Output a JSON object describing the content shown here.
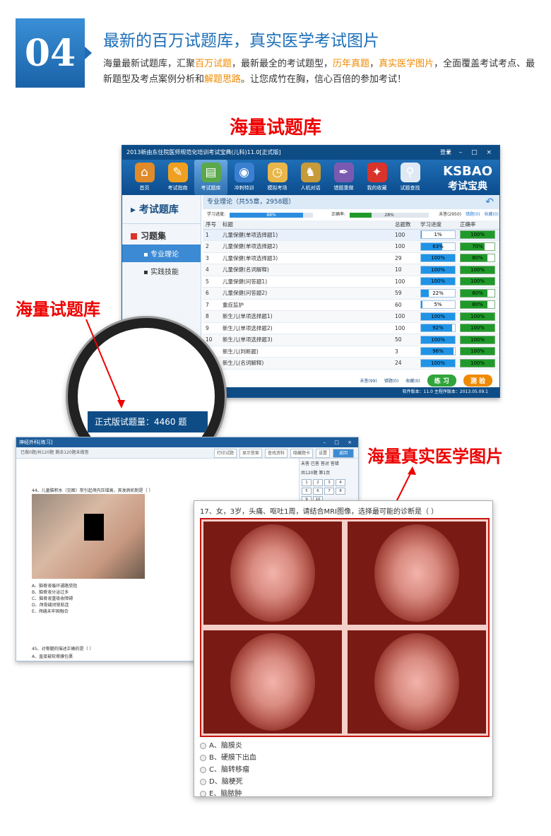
{
  "header": {
    "number": "04",
    "title": "最新的百万试题库，真实医学考试图片",
    "desc_parts": [
      "海量最新试题库，汇聚",
      "百万试题",
      "，最新最全的考试题型，",
      "历年真题",
      "，",
      "真实医学图片",
      "，全面覆盖考试考点、最新题型及考点案例分析和",
      "解题思路",
      "。让您成竹在胸，信心百倍的参加考试！"
    ]
  },
  "section1_title": "海量试题库",
  "app": {
    "window_title": "2013新由东住院医师规范化培训考试宝典(儿科)11.0[正式版]",
    "login": "登录",
    "window_controls": "▾ – □ ×",
    "toolbar": [
      {
        "label": "首页",
        "icon": "home-icon"
      },
      {
        "label": "考试指南",
        "icon": "guide-icon"
      },
      {
        "label": "考试题库",
        "icon": "books-icon"
      },
      {
        "label": "冲刺特训",
        "icon": "globe-icon"
      },
      {
        "label": "模拟考场",
        "icon": "clock-icon"
      },
      {
        "label": "人机对话",
        "icon": "chess-icon"
      },
      {
        "label": "错题重做",
        "icon": "pen-icon"
      },
      {
        "label": "我的收藏",
        "icon": "gift-icon"
      },
      {
        "label": "试题查找",
        "icon": "magnifier-icon"
      }
    ],
    "logo_top": "KSBAO",
    "logo_bottom": "考试宝典",
    "sidebar": {
      "heading": "考试题库",
      "group": "习题集",
      "items": [
        "专业理论",
        "实践技能"
      ]
    },
    "main_heading": "专业理论（共55章，2958题）",
    "study_progress_label": "学习进度:",
    "study_progress_value": "88%",
    "study_progress_fraction": 0.88,
    "accuracy_label": "正确率:",
    "accuracy_value": "28%",
    "accuracy_fraction": 0.28,
    "unread_label": "未答(2950)",
    "wrong_label": "错题(0)",
    "fav_label": "收藏(0)",
    "columns": [
      "序号",
      "标题",
      "总题数",
      "学习进度",
      "正确率"
    ],
    "rows": [
      {
        "no": "1",
        "title": "儿童保健(单项选择题1)",
        "total": "100",
        "progress": "1%",
        "p": 0.01,
        "acc": "100%",
        "a": 1.0
      },
      {
        "no": "2",
        "title": "儿童保健(单项选择题2)",
        "total": "100",
        "progress": "63%",
        "p": 0.63,
        "acc": "70%",
        "a": 0.7
      },
      {
        "no": "3",
        "title": "儿童保健(单项选择题3)",
        "total": "29",
        "progress": "100%",
        "p": 1.0,
        "acc": "80%",
        "a": 0.8
      },
      {
        "no": "4",
        "title": "儿童保健(名词解释)",
        "total": "10",
        "progress": "100%",
        "p": 1.0,
        "acc": "100%",
        "a": 1.0
      },
      {
        "no": "5",
        "title": "儿童保健(问答题1)",
        "total": "100",
        "progress": "100%",
        "p": 1.0,
        "acc": "100%",
        "a": 1.0
      },
      {
        "no": "6",
        "title": "儿童保健(问答题2)",
        "total": "59",
        "progress": "22%",
        "p": 0.22,
        "acc": "80%",
        "a": 0.8
      },
      {
        "no": "7",
        "title": "重症监护",
        "total": "60",
        "progress": "5%",
        "p": 0.05,
        "acc": "80%",
        "a": 0.8
      },
      {
        "no": "8",
        "title": "新生儿(单项选择题1)",
        "total": "100",
        "progress": "100%",
        "p": 1.0,
        "acc": "100%",
        "a": 1.0
      },
      {
        "no": "9",
        "title": "新生儿(单项选择题2)",
        "total": "100",
        "progress": "92%",
        "p": 0.92,
        "acc": "100%",
        "a": 1.0
      },
      {
        "no": "10",
        "title": "新生儿(单项选择题3)",
        "total": "50",
        "progress": "100%",
        "p": 1.0,
        "acc": "100%",
        "a": 1.0
      },
      {
        "no": "11",
        "title": "新生儿(判断题)",
        "total": "3",
        "progress": "96%",
        "p": 0.96,
        "acc": "100%",
        "a": 1.0
      },
      {
        "no": "12",
        "title": "新生儿(名词解释)",
        "total": "24",
        "progress": "100%",
        "p": 1.0,
        "acc": "100%",
        "a": 1.0
      }
    ],
    "foot_unread": "未答(99)",
    "foot_wrong": "错题(0)",
    "foot_fav": "收藏(0)",
    "practice_btn": "练 习",
    "test_btn": "测 验",
    "status": "软件版本：11.0  主程序版本：2013.05.09.1"
  },
  "magnifier_count": "正式版试题量：4460 题",
  "left_label": "海量试题库",
  "win2": {
    "title": "神经外科[练习]",
    "info": "已做0题/共120题    剩余120题未做答",
    "buttons": [
      "打印试题",
      "显示答案",
      "查找资料",
      "隐藏题卡",
      "设置",
      "返回"
    ],
    "legend": "未答  已答  答对  答错",
    "page": "共120题  第1页",
    "q44": "44、儿童脑积水（见图）常引起颅内压增高，其发病机制是（   ）",
    "q44_options": [
      "A、脑脊液循环通路受阻",
      "B、脑脊液分泌过多",
      "C、脑脊液重吸收障碍",
      "D、颅骨缝闭锁粘连",
      "E、颅缝未牢固融合"
    ],
    "q45": "45、对脊髓的描述正确的是（   ）",
    "q45_option": "A、直接被软脊膜包裹"
  },
  "right_label": "海量真实医学图片",
  "win3": {
    "question": "17、女，3岁，头痛、呕吐1周，请结合MRI图像，选择最可能的诊断是（   ）",
    "options": [
      "A、脑膜炎",
      "B、硬膜下出血",
      "C、脑转移瘤",
      "D、脑梗死",
      "E、脑脓肿"
    ]
  }
}
